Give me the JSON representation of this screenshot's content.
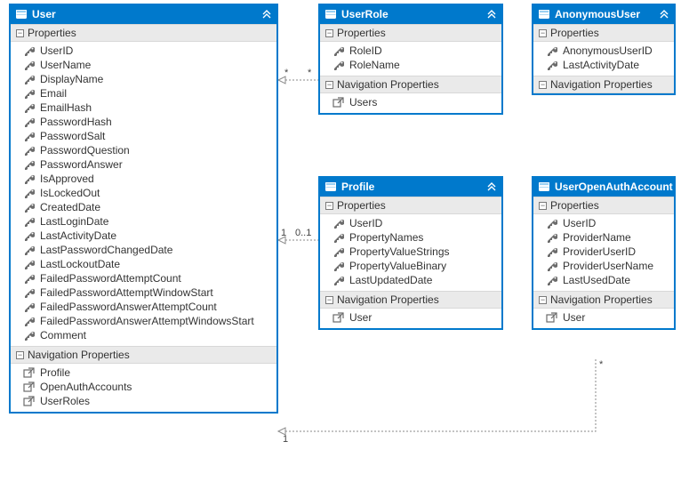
{
  "entities": {
    "user": {
      "title": "User",
      "sections": {
        "properties": "Properties",
        "nav": "Navigation Properties"
      },
      "props": [
        "UserID",
        "UserName",
        "DisplayName",
        "Email",
        "EmailHash",
        "PasswordHash",
        "PasswordSalt",
        "PasswordQuestion",
        "PasswordAnswer",
        "IsApproved",
        "IsLockedOut",
        "CreatedDate",
        "LastLoginDate",
        "LastActivityDate",
        "LastPasswordChangedDate",
        "LastLockoutDate",
        "FailedPasswordAttemptCount",
        "FailedPasswordAttemptWindowStart",
        "FailedPasswordAnswerAttemptCount",
        "FailedPasswordAnswerAttemptWindowsStart",
        "Comment"
      ],
      "navs": [
        "Profile",
        "OpenAuthAccounts",
        "UserRoles"
      ]
    },
    "userRole": {
      "title": "UserRole",
      "sections": {
        "properties": "Properties",
        "nav": "Navigation Properties"
      },
      "props": [
        "RoleID",
        "RoleName"
      ],
      "navs": [
        "Users"
      ]
    },
    "anonymousUser": {
      "title": "AnonymousUser",
      "sections": {
        "properties": "Properties",
        "nav": "Navigation Properties"
      },
      "props": [
        "AnonymousUserID",
        "LastActivityDate"
      ],
      "navs": []
    },
    "profile": {
      "title": "Profile",
      "sections": {
        "properties": "Properties",
        "nav": "Navigation Properties"
      },
      "props": [
        "UserID",
        "PropertyNames",
        "PropertyValueStrings",
        "PropertyValueBinary",
        "LastUpdatedDate"
      ],
      "navs": [
        "User"
      ]
    },
    "userOpenAuthAccount": {
      "title": "UserOpenAuthAccount",
      "sections": {
        "properties": "Properties",
        "nav": "Navigation Properties"
      },
      "props": [
        "UserID",
        "ProviderName",
        "ProviderUserID",
        "ProviderUserName",
        "LastUsedDate"
      ],
      "navs": [
        "User"
      ]
    }
  },
  "multiplicities": {
    "user_userRole_left": "*",
    "user_userRole_right": "*",
    "user_profile_left": "1",
    "user_profile_right": "0..1",
    "user_openAuth_left": "1",
    "user_openAuth_right": "*"
  }
}
